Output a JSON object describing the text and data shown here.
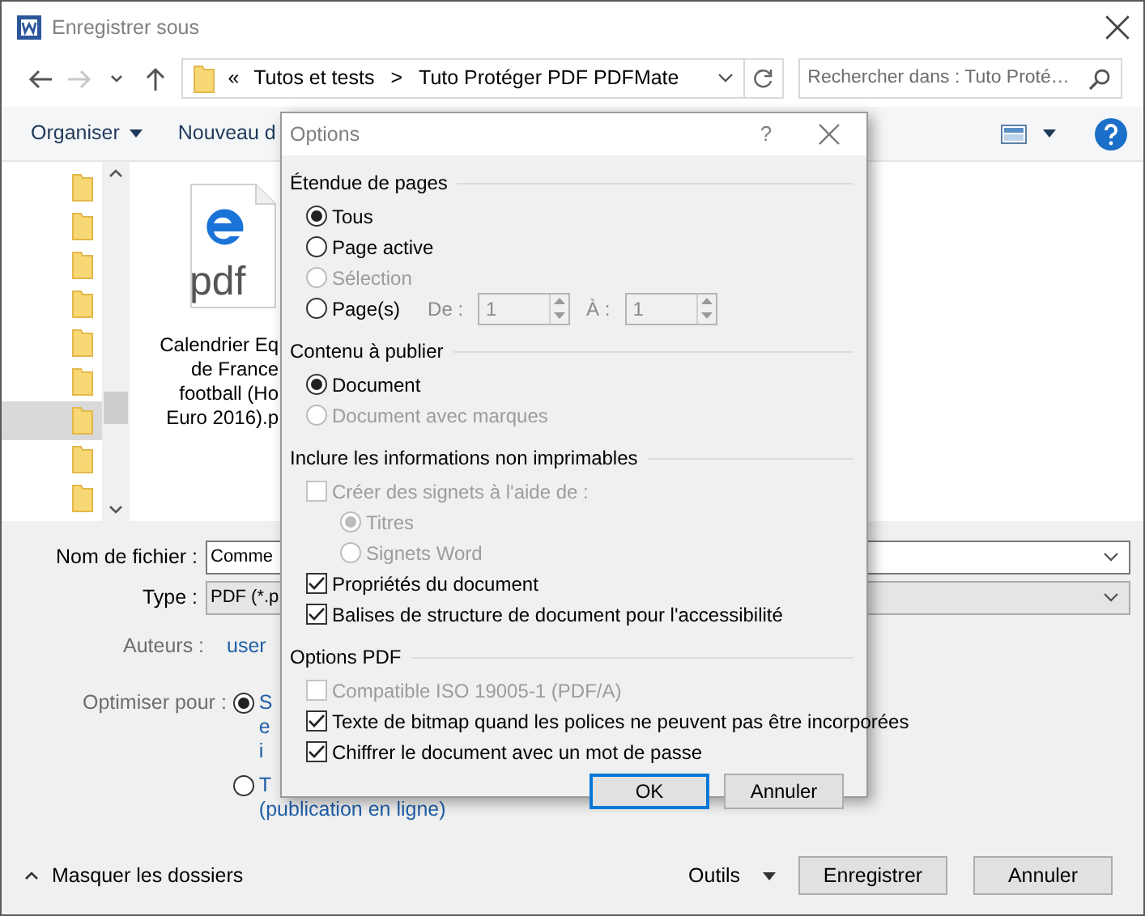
{
  "window": {
    "title": "Enregistrer sous"
  },
  "nav_buttons": [
    {
      "kind": "back",
      "disabled": false
    },
    {
      "kind": "forward",
      "disabled": true
    },
    {
      "kind": "recent",
      "disabled": false
    },
    {
      "kind": "up",
      "disabled": false
    }
  ],
  "address": {
    "prefix": "«",
    "segments": [
      "Tutos et tests",
      "Tuto Protéger PDF PDFMate"
    ],
    "separator": ">"
  },
  "search": {
    "placeholder": "Rechercher dans : Tuto Proté…"
  },
  "toolbar": {
    "items": [
      {
        "label": "Organiser",
        "caret": true
      },
      {
        "label": "Nouveau d",
        "caret": false
      }
    ]
  },
  "nav_pane": {
    "items": [
      {
        "selected": false
      },
      {
        "selected": false
      },
      {
        "selected": false
      },
      {
        "selected": false
      },
      {
        "selected": false
      },
      {
        "selected": false
      },
      {
        "selected": true
      },
      {
        "selected": false
      },
      {
        "selected": false
      }
    ]
  },
  "files": [
    {
      "kind": "pdf",
      "icon_text": "pdf",
      "name_lines": [
        "Calendrier Eq",
        "de France",
        "football (Ho",
        "Euro 2016).p"
      ]
    }
  ],
  "filename": {
    "label": "Nom de fichier :",
    "value": "Comme"
  },
  "type": {
    "label": "Type :",
    "value": "PDF (*.p"
  },
  "authors": {
    "label": "Auteurs :",
    "value": "user"
  },
  "optimize": {
    "label": "Optimiser pour :",
    "options": [
      {
        "lines": [
          "S",
          "e",
          "i"
        ],
        "selected": true
      },
      {
        "lines": [
          "T",
          "(publication en ligne)"
        ],
        "selected": false
      }
    ]
  },
  "hide_folders": "Masquer les dossiers",
  "tools": "Outils",
  "buttons": [
    {
      "label": "Enregistrer"
    },
    {
      "label": "Annuler"
    }
  ],
  "options_dialog": {
    "title": "Options",
    "help": "?",
    "sections": [
      {
        "title": "Étendue de pages",
        "items": [
          {
            "kind": "radio",
            "label": "Tous",
            "selected": true,
            "disabled": false
          },
          {
            "kind": "radio",
            "label": "Page active",
            "selected": false,
            "disabled": false
          },
          {
            "kind": "radio",
            "label": "Sélection",
            "selected": false,
            "disabled": true
          },
          {
            "kind": "pages",
            "label": "Page(s)",
            "selected": false,
            "disabled": false,
            "from_label": "De :",
            "from": "1",
            "to_label": "À :",
            "to": "1"
          }
        ]
      },
      {
        "title": "Contenu à publier",
        "items": [
          {
            "kind": "radio",
            "label": "Document",
            "selected": true,
            "disabled": false
          },
          {
            "kind": "radio",
            "label": "Document avec marques",
            "selected": false,
            "disabled": true
          }
        ]
      },
      {
        "title": "Inclure les informations non imprimables",
        "items": [
          {
            "kind": "checkbox",
            "label": "Créer des signets à l'aide de :",
            "checked": false,
            "disabled": true,
            "children": [
              {
                "kind": "radio",
                "label": "Titres",
                "selected": true,
                "disabled": true
              },
              {
                "kind": "radio",
                "label": "Signets Word",
                "selected": false,
                "disabled": true
              }
            ]
          },
          {
            "kind": "checkbox",
            "label": "Propriétés du document",
            "checked": true,
            "disabled": false
          },
          {
            "kind": "checkbox",
            "label": "Balises de structure de document pour l'accessibilité",
            "checked": true,
            "disabled": false
          }
        ]
      },
      {
        "title": "Options PDF",
        "items": [
          {
            "kind": "checkbox",
            "label": "Compatible ISO 19005-1 (PDF/A)",
            "checked": false,
            "disabled": true
          },
          {
            "kind": "checkbox",
            "label": "Texte de bitmap quand les polices ne peuvent pas être incorporées",
            "checked": true,
            "disabled": false
          },
          {
            "kind": "checkbox",
            "label": "Chiffrer le document avec un mot de passe",
            "checked": true,
            "disabled": false
          }
        ]
      }
    ],
    "buttons": [
      {
        "label": "OK",
        "default": true
      },
      {
        "label": "Annuler",
        "default": false
      }
    ]
  }
}
